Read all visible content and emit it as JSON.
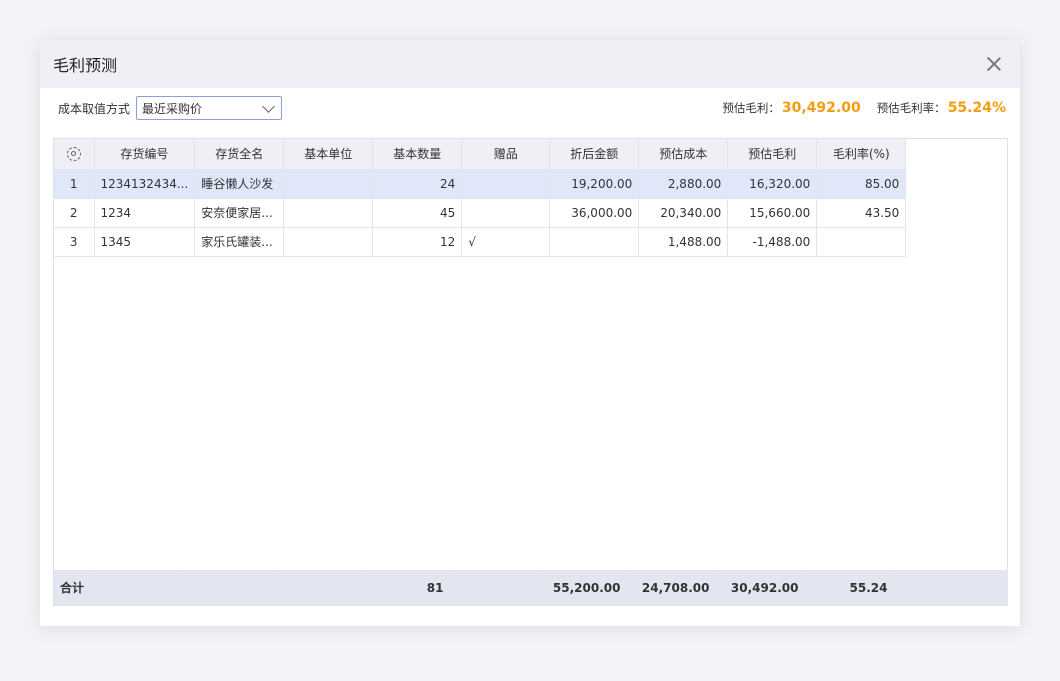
{
  "dialog": {
    "title": "毛利预测"
  },
  "toolbar": {
    "cost_method_label": "成本取值方式",
    "cost_method_value": "最近采购价",
    "est_profit_label": "预估毛利：",
    "est_profit_value": "30,492.00",
    "est_rate_label": "预估毛利率：",
    "est_rate_value": "55.24%"
  },
  "table": {
    "columns": [
      "存货编号",
      "存货全名",
      "基本单位",
      "基本数量",
      "赠品",
      "折后金额",
      "预估成本",
      "预估毛利",
      "毛利率(%)"
    ],
    "rows": [
      [
        "1",
        "1234132434...",
        "睡谷懒人沙发",
        "",
        "24",
        "",
        "19,200.00",
        "2,880.00",
        "16,320.00",
        "85.00"
      ],
      [
        "2",
        "1234",
        "安奈便家居...",
        "",
        "45",
        "",
        "36,000.00",
        "20,340.00",
        "15,660.00",
        "43.50"
      ],
      [
        "3",
        "1345",
        "家乐氏罐装...",
        "",
        "12",
        "√",
        "",
        "1,488.00",
        "-1,488.00",
        ""
      ]
    ],
    "totals": {
      "label": "合计",
      "qty": "81",
      "amount": "55,200.00",
      "cost": "24,708.00",
      "profit": "30,492.00",
      "rate": "55.24"
    }
  },
  "colors": {
    "accent": "#f39c12",
    "selected_row": "#dfe7f8",
    "header_bg": "#eef0f6"
  }
}
